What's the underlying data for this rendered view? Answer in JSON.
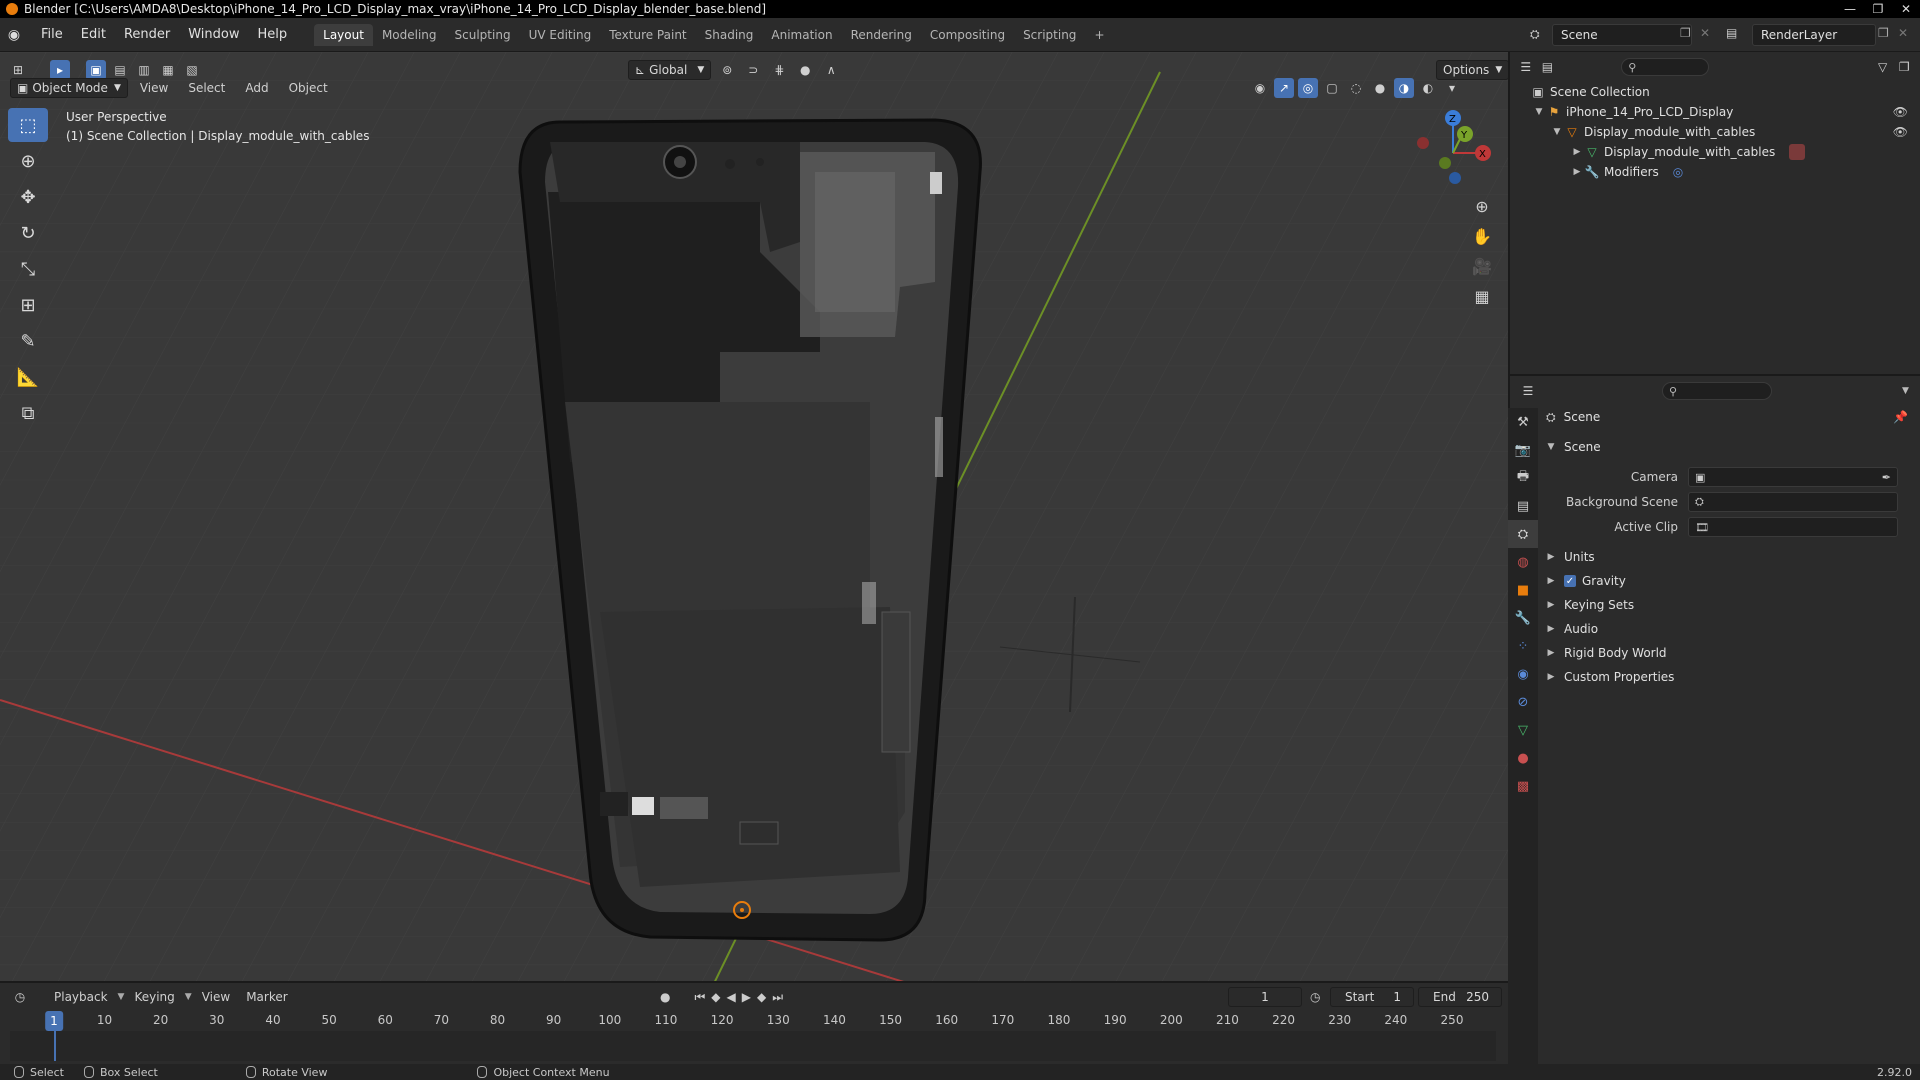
{
  "window": {
    "title": "Blender [C:\\Users\\AMDA8\\Desktop\\iPhone_14_Pro_LCD_Display_max_vray\\iPhone_14_Pro_LCD_Display_blender_base.blend]",
    "minimize": "—",
    "maximize": "❐",
    "close": "✕"
  },
  "menu": [
    "File",
    "Edit",
    "Render",
    "Window",
    "Help"
  ],
  "workspaces": [
    "Layout",
    "Modeling",
    "Sculpting",
    "UV Editing",
    "Texture Paint",
    "Shading",
    "Animation",
    "Rendering",
    "Compositing",
    "Scripting",
    "+"
  ],
  "active_workspace": "Layout",
  "scene_selector": "Scene",
  "view_layer": "RenderLayer",
  "viewport": {
    "mode": "Object Mode",
    "menus": [
      "View",
      "Select",
      "Add",
      "Object"
    ],
    "transform_orientation": "Global",
    "options_label": "Options",
    "perspective_label": "User Perspective",
    "collection_label": "(1) Scene Collection | Display_module_with_cables",
    "gizmo_axes": {
      "x": "X",
      "y": "Y",
      "z": "Z"
    }
  },
  "outliner": {
    "root": "Scene Collection",
    "items": [
      {
        "label": "iPhone_14_Pro_LCD_Display",
        "level": 1,
        "icon": "collection-icon"
      },
      {
        "label": "Display_module_with_cables",
        "level": 2,
        "icon": "object-icon"
      },
      {
        "label": "Display_module_with_cables",
        "level": 3,
        "icon": "mesh-icon"
      },
      {
        "label": "Modifiers",
        "level": 3,
        "icon": "wrench-icon"
      }
    ]
  },
  "properties": {
    "header": "Scene",
    "panel": "Scene",
    "fields": [
      {
        "label": "Camera",
        "value": ""
      },
      {
        "label": "Background Scene",
        "value": ""
      },
      {
        "label": "Active Clip",
        "value": ""
      }
    ],
    "sections": [
      "Units",
      "Gravity",
      "Keying Sets",
      "Audio",
      "Rigid Body World",
      "Custom Properties"
    ],
    "gravity_checked": true
  },
  "timeline": {
    "menus": [
      "Playback",
      "Keying",
      "View",
      "Marker"
    ],
    "current_frame": "1",
    "start_label": "Start",
    "start": "1",
    "end_label": "End",
    "end": "250",
    "ticks": [
      "10",
      "20",
      "30",
      "40",
      "50",
      "60",
      "70",
      "80",
      "90",
      "100",
      "110",
      "120",
      "130",
      "140",
      "150",
      "160",
      "170",
      "180",
      "190",
      "200",
      "210",
      "220",
      "230",
      "240",
      "250"
    ]
  },
  "statusbar": {
    "items": [
      "Select",
      "Box Select",
      "Rotate View",
      "Object Context Menu"
    ],
    "version": "2.92.0"
  },
  "colors": {
    "accent": "#4772b3",
    "x_axis": "#c03838",
    "y_axis": "#7aa32a",
    "z_axis": "#3a7dd9",
    "object_orange": "#e87d0d"
  }
}
